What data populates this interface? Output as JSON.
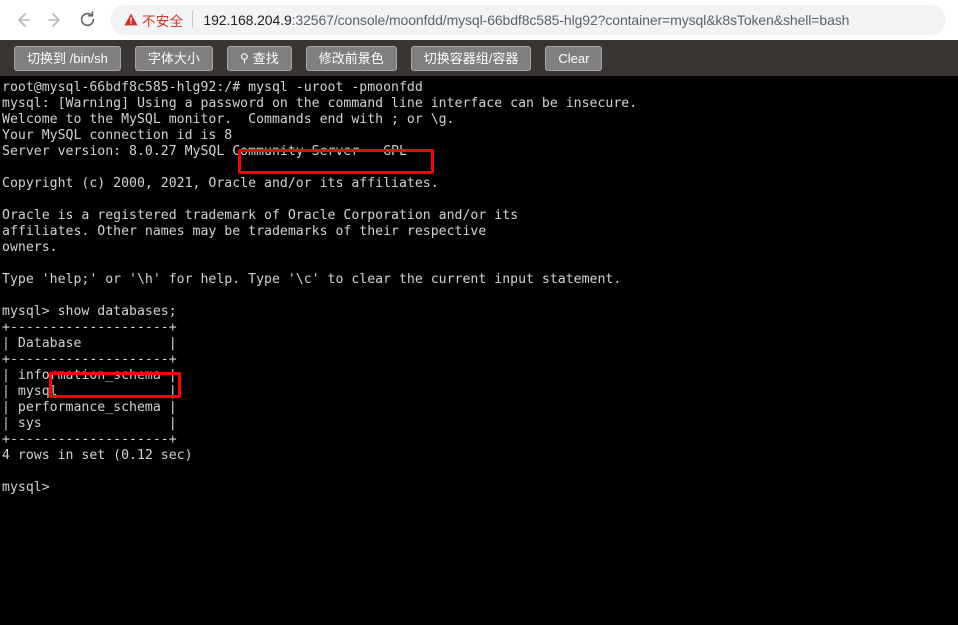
{
  "browser": {
    "back_label": "Back",
    "forward_label": "Forward",
    "reload_label": "Reload",
    "security": {
      "warning_icon": "warning-triangle-icon",
      "label": "不安全"
    },
    "url": {
      "full": "192.168.204.9:32567/console/moonfdd/mysql-66bdf8c585-hlg92?container=mysql&k8sToken&shell=bash",
      "host": "192.168.204.9",
      "rest": ":32567/console/moonfdd/mysql-66bdf8c585-hlg92?container=mysql&k8sToken&shell=bash"
    }
  },
  "toolbar": {
    "buttons": [
      {
        "label": "切换到 /bin/sh",
        "icon": null
      },
      {
        "label": "字体大小",
        "icon": null
      },
      {
        "label": "查找",
        "icon": "search-icon"
      },
      {
        "label": "修改前景色",
        "icon": null
      },
      {
        "label": "切换容器组/容器",
        "icon": null
      },
      {
        "label": "Clear",
        "icon": null
      }
    ]
  },
  "terminal": {
    "prompt_user_host": "root@mysql-66bdf8c585-hlg92:/#",
    "typed_command": "mysql -uroot -pmoonfdd",
    "sql_prompt": "mysql>",
    "typed_sql": "show databases;",
    "content": "root@mysql-66bdf8c585-hlg92:/# mysql -uroot -pmoonfdd\nmysql: [Warning] Using a password on the command line interface can be insecure.\nWelcome to the MySQL monitor.  Commands end with ; or \\g.\nYour MySQL connection id is 8\nServer version: 8.0.27 MySQL Community Server - GPL\n\nCopyright (c) 2000, 2021, Oracle and/or its affiliates.\n\nOracle is a registered trademark of Oracle Corporation and/or its\naffiliates. Other names may be trademarks of their respective\nowners.\n\nType 'help;' or '\\h' for help. Type '\\c' to clear the current input statement.\n\nmysql> show databases;\n+--------------------+\n| Database           |\n+--------------------+\n| information_schema |\n| mysql              |\n| performance_schema |\n| sys                |\n+--------------------+\n4 rows in set (0.12 sec)\n\nmysql>",
    "result_summary": "4 rows in set (0.12 sec)",
    "databases": [
      "information_schema",
      "mysql",
      "performance_schema",
      "sys"
    ],
    "table_header": "Database",
    "server_version": "8.0.27 MySQL Community Server - GPL",
    "connection_id": "8"
  },
  "annotations": {
    "highlight_color": "#ff0000",
    "boxes": [
      {
        "name": "mysql-login-command",
        "text": "mysql -uroot -pmoonfdd"
      },
      {
        "name": "show-databases-command",
        "text": "show databases;"
      }
    ]
  },
  "colors": {
    "terminal_bg": "#000000",
    "terminal_fg": "#cfd2d6",
    "toolbar_bg": "#3a3433",
    "button_bg": "#7f7f7f",
    "omnibox_bg": "#f1f3f4",
    "not_secure": "#d93025"
  }
}
